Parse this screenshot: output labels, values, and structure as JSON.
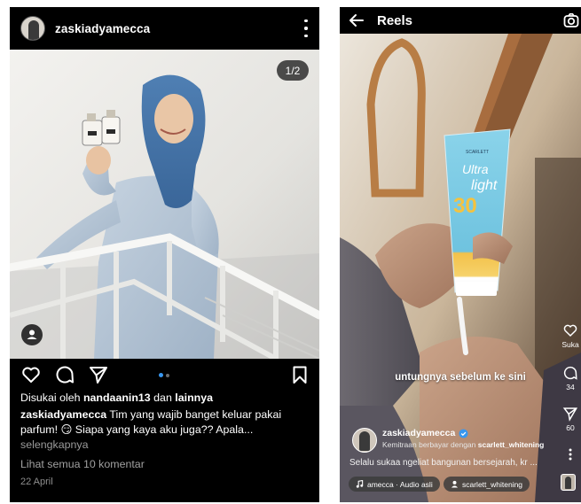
{
  "post": {
    "username": "zaskiadyamecca",
    "image_counter": "1/2",
    "likes": {
      "prefix": "Disukai oleh",
      "liker": "nandaanin13",
      "joiner": "dan",
      "others": "lainnya"
    },
    "caption": {
      "author": "zaskiadyamecca",
      "text_line1": "Tim yang wajib banget keluar pakai",
      "text_line2": "parfum! 😏 Siapa yang kaya aku juga?? Apala...",
      "more": "selengkapnya"
    },
    "comments_link": "Lihat semua 10 komentar",
    "date": "22 April",
    "carousel_dots": 2,
    "carousel_active_index": 0,
    "icons": [
      "more-vertical-icon",
      "heart-icon",
      "comment-icon",
      "share-icon",
      "bookmark-icon",
      "user-tag-icon"
    ]
  },
  "reel": {
    "title": "Reels",
    "overlay_text": "untungnya sebelum ke sini",
    "username": "zaskiadyamecca",
    "verified": true,
    "partnership": {
      "prefix": "Kemitraan berbayar dengan",
      "partner": "scarlett_whitening"
    },
    "caption": "Selalu sukaa ngeliat bangunan bersejarah, kr ...",
    "audio": "amecca · Audio asli",
    "tagged": "scarlett_whitening",
    "side": {
      "like_label": "Suka",
      "comments_count": "34",
      "shares_count": "60"
    },
    "product_text": {
      "brand": "SCARLETT",
      "name_line1": "Ultra",
      "name_line2": "light",
      "spf": "30"
    },
    "icons": [
      "back-arrow-icon",
      "camera-icon",
      "heart-icon",
      "comment-icon",
      "share-icon",
      "more-vertical-icon",
      "music-note-icon",
      "user-tag-icon",
      "verified-badge-icon"
    ]
  },
  "colors": {
    "background": "#000000",
    "muted_text": "#9a9a9a",
    "carousel_active": "#3897f0",
    "verified": "#3897f0"
  }
}
